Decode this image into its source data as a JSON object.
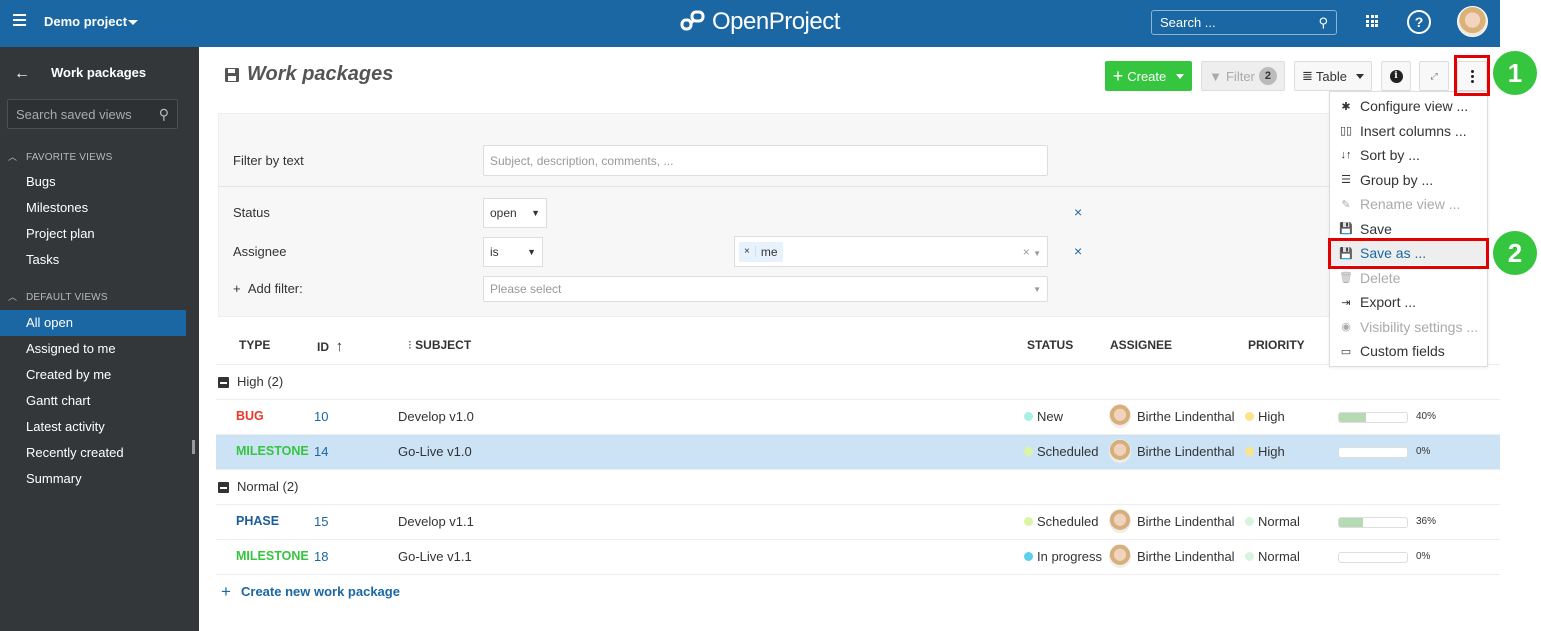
{
  "header": {
    "project": "Demo project",
    "logo": "OpenProject",
    "search_placeholder": "Search ...",
    "icons": [
      "hamburger-icon",
      "search-icon",
      "modules-grid-icon",
      "help-icon",
      "user-avatar"
    ]
  },
  "sidebar": {
    "title": "Work packages",
    "search_placeholder": "Search saved views",
    "favorite_heading": "FAVORITE VIEWS",
    "favorites": [
      "Bugs",
      "Milestones",
      "Project plan",
      "Tasks"
    ],
    "default_heading": "DEFAULT VIEWS",
    "defaults": [
      "All open",
      "Assigned to me",
      "Created by me",
      "Gantt chart",
      "Latest activity",
      "Recently created",
      "Summary"
    ],
    "active": "All open"
  },
  "page": {
    "title": "Work packages"
  },
  "toolbar": {
    "create": "Create",
    "filter": "Filter",
    "filter_count": "2",
    "view_mode": "Table",
    "info_icon": "i",
    "fullscreen_icon": "⤢"
  },
  "filters": {
    "text_label": "Filter by text",
    "text_placeholder": "Subject, description, comments, ...",
    "status_label": "Status",
    "status_value": "open",
    "assignee_label": "Assignee",
    "assignee_operator": "is",
    "assignee_tag": "me",
    "add_filter_label": "Add filter:",
    "add_filter_placeholder": "Please select",
    "remove_glyph": "×"
  },
  "table": {
    "columns": [
      "TYPE",
      "ID",
      "SUBJECT",
      "STATUS",
      "ASSIGNEE",
      "PRIORITY"
    ],
    "sort_indicator": "↑",
    "groups": [
      {
        "label": "High (2)",
        "rows": [
          {
            "type": "BUG",
            "type_color": "#e8392a",
            "id": "10",
            "subject": "Develop v1.0",
            "status": "New",
            "status_color": "#a8f0e3",
            "assignee": "Birthe Lindenthal",
            "priority": "High",
            "priority_color": "#fbe38b",
            "progress": 40,
            "progress_label": "40%",
            "selected": false
          },
          {
            "type": "MILESTONE",
            "type_color": "#35c53f",
            "id": "14",
            "subject": "Go-Live v1.0",
            "status": "Scheduled",
            "status_color": "#dcf5a4",
            "assignee": "Birthe Lindenthal",
            "priority": "High",
            "priority_color": "#fbe38b",
            "progress": 0,
            "progress_label": "0%",
            "selected": true
          }
        ]
      },
      {
        "label": "Normal (2)",
        "rows": [
          {
            "type": "PHASE",
            "type_color": "#1a5c99",
            "id": "15",
            "subject": "Develop v1.1",
            "status": "Scheduled",
            "status_color": "#dcf5a4",
            "assignee": "Birthe Lindenthal",
            "priority": "Normal",
            "priority_color": "#d6f5dc",
            "progress": 36,
            "progress_label": "36%",
            "selected": false
          },
          {
            "type": "MILESTONE",
            "type_color": "#35c53f",
            "id": "18",
            "subject": "Go-Live v1.1",
            "status": "In progress",
            "status_color": "#5ad0ec",
            "assignee": "Birthe Lindenthal",
            "priority": "Normal",
            "priority_color": "#d6f5dc",
            "progress": 0,
            "progress_label": "0%",
            "selected": false
          }
        ]
      }
    ],
    "create_link": "Create new work package"
  },
  "dropdown": {
    "items": [
      {
        "label": "Configure view ...",
        "icon": "gear-icon",
        "glyph": "✱",
        "disabled": false
      },
      {
        "label": "Insert columns ...",
        "icon": "columns-icon",
        "glyph": "▯▯",
        "disabled": false
      },
      {
        "label": "Sort by ...",
        "icon": "sort-icon",
        "glyph": "↓↑",
        "disabled": false
      },
      {
        "label": "Group by ...",
        "icon": "group-icon",
        "glyph": "☰",
        "disabled": false
      },
      {
        "label": "Rename view ...",
        "icon": "pencil-icon",
        "glyph": "✎",
        "disabled": true
      },
      {
        "label": "Save",
        "icon": "save-icon",
        "glyph": "💾",
        "disabled": false
      },
      {
        "label": "Save as ...",
        "icon": "save-as-icon",
        "glyph": "💾",
        "disabled": false,
        "hover": true
      },
      {
        "label": "Delete",
        "icon": "trash-icon",
        "glyph": "🗑",
        "disabled": true
      },
      {
        "label": "Export ...",
        "icon": "export-icon",
        "glyph": "⇥",
        "disabled": false
      },
      {
        "label": "Visibility settings ...",
        "icon": "eye-icon",
        "glyph": "◉",
        "disabled": true
      },
      {
        "label": "Custom fields",
        "icon": "custom-fields-icon",
        "glyph": "▭",
        "disabled": false
      }
    ]
  },
  "annotations": {
    "step1": "1",
    "step2": "2",
    "highlight_color": "#e20000",
    "callout_color": "#35c53f"
  }
}
